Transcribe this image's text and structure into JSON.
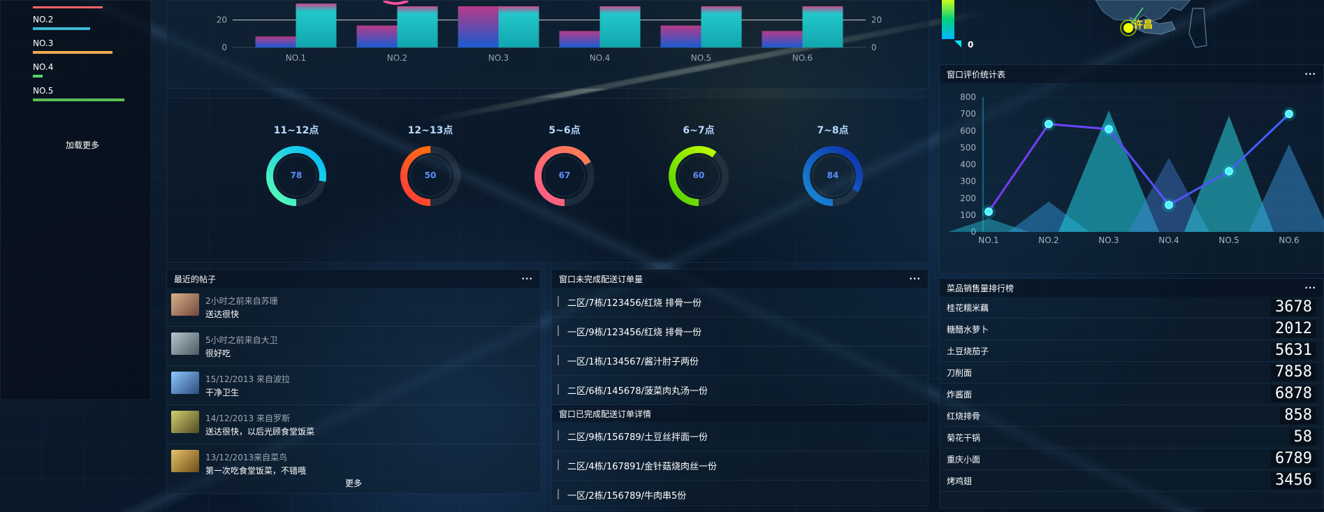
{
  "left_rank": {
    "items": [
      {
        "label": "NO.2",
        "color": "#3bb7d7",
        "value": 0.51
      },
      {
        "label": "NO.3",
        "color": "#f1a84f",
        "value": 0.71
      },
      {
        "label": "NO.4",
        "color": "#53d26a",
        "value": 0.09
      },
      {
        "label": "NO.5",
        "color": "#5bbf55",
        "value": 0.82
      }
    ],
    "load_more": "加载更多"
  },
  "top_chart": {
    "chart_data": {
      "type": "bar",
      "categories": [
        "NO.1",
        "NO.2",
        "NO.3",
        "NO.4",
        "NO.5",
        "NO.6"
      ],
      "series": [
        {
          "values": [
            8,
            16,
            30,
            12,
            16,
            12
          ]
        },
        {
          "values": [
            32,
            30,
            30,
            30,
            30,
            30
          ]
        }
      ],
      "y_ticks": [
        "0",
        "20"
      ],
      "ylim": [
        0,
        30
      ]
    }
  },
  "rings": {
    "items": [
      {
        "title": "11~12点",
        "value": "78",
        "color_a": "#00b8ff",
        "color_b": "#5cffb1"
      },
      {
        "title": "12~13点",
        "value": "50",
        "color_a": "#ff7f00",
        "color_b": "#ff3a3a"
      },
      {
        "title": "5~6点",
        "value": "67",
        "color_a": "#ff7f50",
        "color_b": "#ff5a8a"
      },
      {
        "title": "6~7点",
        "value": "60",
        "color_a": "#ccff00",
        "color_b": "#4fd100"
      },
      {
        "title": "7~8点",
        "value": "84",
        "color_a": "#0d2da9",
        "color_b": "#198dd8"
      }
    ]
  },
  "posts": {
    "title": "最近的帖子",
    "more": "更多",
    "items": [
      {
        "meta": "2小时之前来自苏珊",
        "text": "送达很快",
        "avatar_a": "#d7b28c",
        "avatar_b": "#74463b"
      },
      {
        "meta": "5小时之前来自大卫",
        "text": "很好吃",
        "avatar_a": "#b7c7cc",
        "avatar_b": "#4b5962"
      },
      {
        "meta": "15/12/2013 来自波拉",
        "text": "干净卫生",
        "avatar_a": "#8cc9ff",
        "avatar_b": "#2c4c7d"
      },
      {
        "meta": "14/12/2013 来自罗斯",
        "text": "送达很快，以后光顾食堂饭菜",
        "avatar_a": "#d6d06e",
        "avatar_b": "#4f4b23"
      },
      {
        "meta": "13/12/2013来自菜鸟",
        "text": "第一次吃食堂饭菜，不错哦",
        "avatar_a": "#e7c36a",
        "avatar_b": "#6f4b17"
      }
    ]
  },
  "orders": {
    "title": "窗口未完成配送订单量",
    "items": [
      "二区/7栋/123456/红烧 排骨一份",
      "一区/9栋/123456/红烧 排骨一份",
      "一区/1栋/134567/酱汁肘子两份",
      "二区/6栋/145678/菠菜肉丸汤一份"
    ],
    "completed_title": "窗口已完成配送订单详情",
    "completed_items": [
      "二区/9栋/156789/土豆丝拌面一份",
      "二区/4栋/167891/金针菇烧肉丝一份",
      "一区/2栋/156789/牛肉串5份"
    ]
  },
  "map_overlay": {
    "legend_zero": "0",
    "label": "许昌"
  },
  "evaluation": {
    "title": "窗口评价统计表",
    "chart_data": {
      "type": "line",
      "categories": [
        "NO.1",
        "NO.2",
        "NO.3",
        "NO.4",
        "NO.5",
        "NO.6"
      ],
      "series": [
        {
          "values": [
            120,
            640,
            610,
            160,
            360,
            700
          ]
        }
      ],
      "area_overlay": [
        80,
        180,
        720,
        440,
        690,
        520
      ],
      "y_ticks": [
        "0",
        "100",
        "200",
        "300",
        "400",
        "500",
        "600",
        "700",
        "800"
      ],
      "ylim": [
        0,
        800
      ]
    }
  },
  "sales": {
    "title": "菜品销售量排行榜",
    "items": [
      {
        "name": "桂花糯米藕",
        "value": "3678"
      },
      {
        "name": "糖醋水萝卜",
        "value": "2012"
      },
      {
        "name": "土豆烧茄子",
        "value": "5631"
      },
      {
        "name": "刀削面",
        "value": "7858"
      },
      {
        "name": "炸酱面",
        "value": "6878"
      },
      {
        "name": "红烧排骨",
        "value": "858"
      },
      {
        "name": "菊花干锅",
        "value": "58"
      },
      {
        "name": "重庆小面",
        "value": "6789"
      },
      {
        "name": "烤鸡翅",
        "value": "3456"
      }
    ]
  }
}
